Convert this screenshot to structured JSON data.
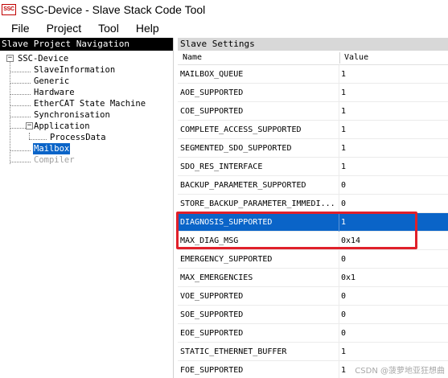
{
  "window": {
    "icon_text": "SSC",
    "title": "SSC-Device - Slave Stack Code Tool"
  },
  "menu": [
    "File",
    "Project",
    "Tool",
    "Help"
  ],
  "left_pane": {
    "header": "Slave Project Navigation",
    "tree": [
      {
        "label": "SSC-Device",
        "level": 0,
        "expander": "−"
      },
      {
        "label": "SlaveInformation",
        "level": 1
      },
      {
        "label": "Generic",
        "level": 1
      },
      {
        "label": "Hardware",
        "level": 1
      },
      {
        "label": "EtherCAT State Machine",
        "level": 1
      },
      {
        "label": "Synchronisation",
        "level": 1
      },
      {
        "label": "Application",
        "level": 1,
        "expander": "−"
      },
      {
        "label": "ProcessData",
        "level": 2
      },
      {
        "label": "Mailbox",
        "level": 1,
        "state": "selected"
      },
      {
        "label": "Compiler",
        "level": 1,
        "state": "disabled"
      }
    ]
  },
  "right_pane": {
    "header": "Slave Settings",
    "columns": [
      "Name",
      "Value"
    ],
    "rows": [
      {
        "name": "MAILBOX_QUEUE",
        "value": "1"
      },
      {
        "name": "AOE_SUPPORTED",
        "value": "1"
      },
      {
        "name": "COE_SUPPORTED",
        "value": "1"
      },
      {
        "name": "COMPLETE_ACCESS_SUPPORTED",
        "value": "1"
      },
      {
        "name": "SEGMENTED_SDO_SUPPORTED",
        "value": "1"
      },
      {
        "name": "SDO_RES_INTERFACE",
        "value": "1"
      },
      {
        "name": "BACKUP_PARAMETER_SUPPORTED",
        "value": "0"
      },
      {
        "name": "STORE_BACKUP_PARAMETER_IMMEDI...",
        "value": "0"
      },
      {
        "name": "DIAGNOSIS_SUPPORTED",
        "value": "1",
        "selected": true
      },
      {
        "name": "MAX_DIAG_MSG",
        "value": "0x14"
      },
      {
        "name": "EMERGENCY_SUPPORTED",
        "value": "0"
      },
      {
        "name": "MAX_EMERGENCIES",
        "value": "0x1"
      },
      {
        "name": "VOE_SUPPORTED",
        "value": "0"
      },
      {
        "name": "SOE_SUPPORTED",
        "value": "0"
      },
      {
        "name": "EOE_SUPPORTED",
        "value": "0"
      },
      {
        "name": "STATIC_ETHERNET_BUFFER",
        "value": "1"
      },
      {
        "name": "FOE_SUPPORTED",
        "value": "1"
      }
    ]
  },
  "watermark": "CSDN @菠萝地亚狂想曲",
  "colors": {
    "selection": "#0a64c8",
    "annotation_box": "#e0202a",
    "left_header_bg": "#000000",
    "right_header_bg": "#d8d8d8"
  }
}
